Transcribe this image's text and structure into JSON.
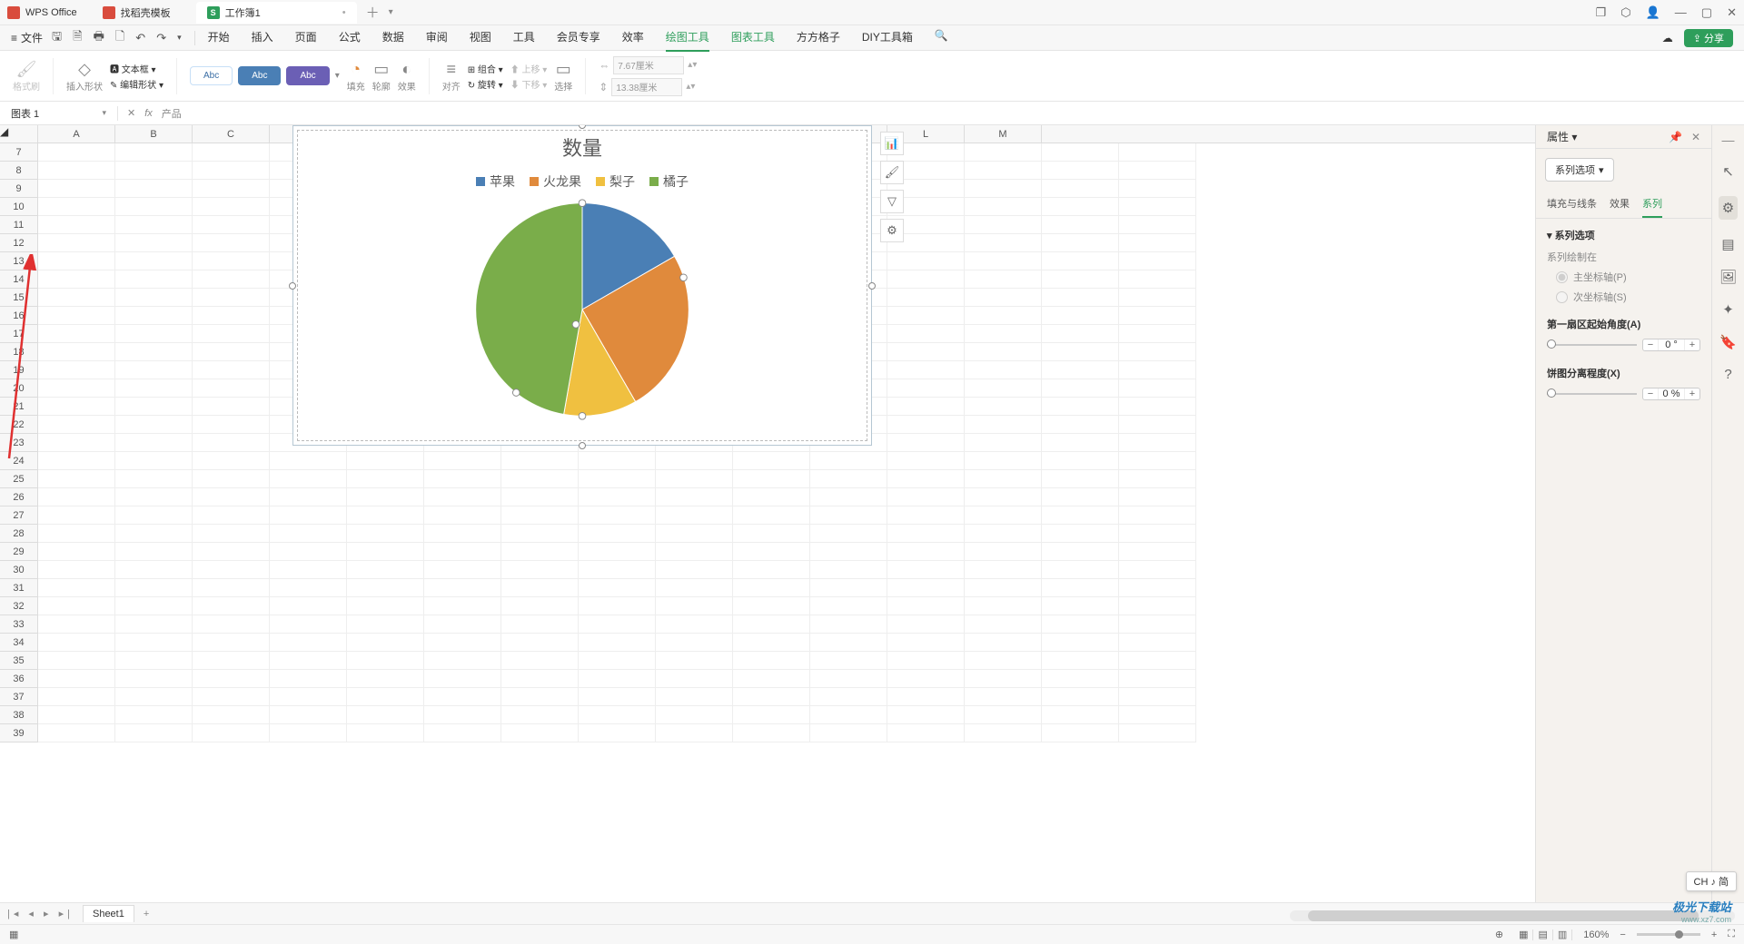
{
  "title_bar": {
    "app_name": "WPS Office",
    "tab_templates": "找稻壳模板",
    "tab_workbook": "工作簿1",
    "tab_icon_s": "S"
  },
  "menu": {
    "file": "文件",
    "tabs": [
      "开始",
      "插入",
      "页面",
      "公式",
      "数据",
      "审阅",
      "视图",
      "工具",
      "会员专享",
      "效率",
      "绘图工具",
      "图表工具",
      "方方格子",
      "DIY工具箱"
    ],
    "active_index": 10,
    "share": "分享"
  },
  "ribbon": {
    "format_painter": "格式刷",
    "insert_shape": "插入形状",
    "edit_shape": "编辑形状",
    "text_box": "文本框",
    "abc_labels": [
      "Abc",
      "Abc",
      "Abc"
    ],
    "fill": "填充",
    "outline": "轮廓",
    "effect": "效果",
    "align": "对齐",
    "group": "组合",
    "rotate": "旋转",
    "move_up": "上移",
    "move_down": "下移",
    "select": "选择",
    "width": "7.67厘米",
    "height": "13.38厘米"
  },
  "formula_bar": {
    "name_box": "图表 1",
    "content": "产品"
  },
  "columns": [
    "A",
    "B",
    "C",
    "D",
    "E",
    "F",
    "G",
    "H",
    "I",
    "J",
    "K",
    "L",
    "M"
  ],
  "row_start": 7,
  "row_end": 39,
  "sheet": {
    "name": "Sheet1"
  },
  "status": {
    "zoom": "160%"
  },
  "chart_tools": [
    "chart-style",
    "brush",
    "filter",
    "settings"
  ],
  "prop_panel": {
    "title": "属性",
    "dropdown": "系列选项",
    "subtabs": [
      "填充与线条",
      "效果",
      "系列"
    ],
    "active_subtab": 2,
    "series_options": "系列选项",
    "series_drawn_on": "系列绘制在",
    "primary_axis": "主坐标轴(P)",
    "secondary_axis": "次坐标轴(S)",
    "first_slice_angle": "第一扇区起始角度(A)",
    "angle_value": "0",
    "angle_unit": "°",
    "explosion": "饼图分离程度(X)",
    "explosion_value": "0",
    "explosion_unit": "%"
  },
  "ime": "CH ♪ 简",
  "watermark": {
    "line1": "极光下载站",
    "line2": "www.xz7.com"
  },
  "chart_data": {
    "type": "pie",
    "title": "数量",
    "categories": [
      "苹果",
      "火龙果",
      "梨子",
      "橘子"
    ],
    "values": [
      60,
      90,
      40,
      170
    ],
    "colors": [
      "#4a7fb5",
      "#e08a3c",
      "#f0c040",
      "#7aad4a"
    ]
  }
}
